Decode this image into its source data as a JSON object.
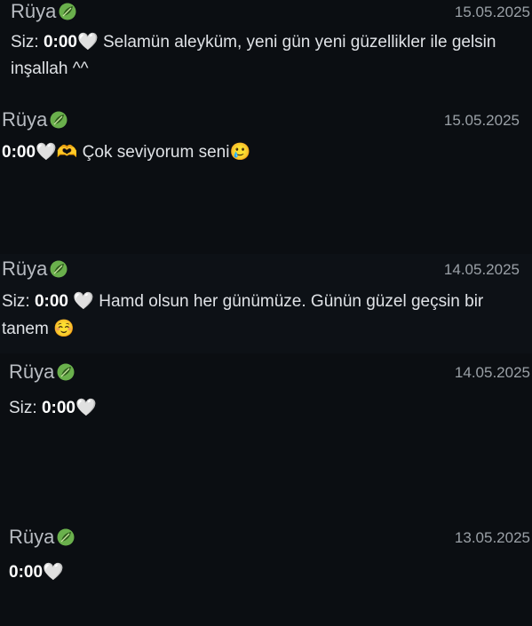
{
  "conversations": [
    {
      "name": "Rüya",
      "date": "15.05.2025",
      "sender_prefix": "Siz:",
      "time_bold": "0:00",
      "heart": "🤍",
      "text": " Selamün aleyküm, yeni gün yeni güzellikler ile gelsin inşallah ^^"
    },
    {
      "name": "Rüya",
      "date": "15.05.2025",
      "time_bold": "0:00",
      "heart": "🤍",
      "emoji1": "🫶",
      "text": " Çok seviyorum seni",
      "emoji2": "🥲"
    },
    {
      "name": "Rüya",
      "date": "14.05.2025",
      "sender_prefix": "Siz:",
      "time_bold": "0:00",
      "heart": "🤍",
      "text": "  Hamd olsun her günümüze. Günün güzel geçsin bir tanem",
      "emoji1": "☺️"
    },
    {
      "name": "Rüya",
      "date": "14.05.2025",
      "sender_prefix": "Siz:",
      "time_bold": "0:00",
      "heart": "🤍"
    },
    {
      "name": "Rüya",
      "date": "13.05.2025",
      "time_bold": "0:00",
      "heart": "🤍"
    }
  ],
  "icons": {
    "name_badge": "leaf-icon"
  },
  "colors": {
    "background": "#0b0e12",
    "leaf_green": "#6ab04c"
  }
}
